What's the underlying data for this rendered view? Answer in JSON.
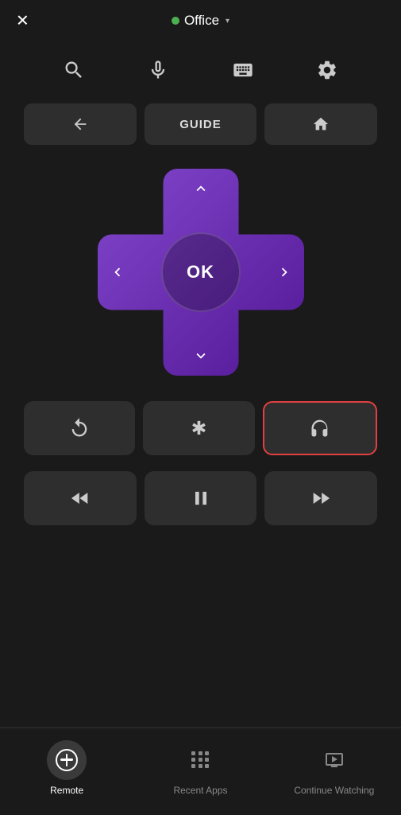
{
  "header": {
    "close_label": "✕",
    "device_name": "Office",
    "dropdown_arrow": "▾",
    "status_color": "#4CAF50"
  },
  "toolbar": {
    "search_label": "search",
    "mic_label": "microphone",
    "keyboard_label": "keyboard",
    "settings_label": "settings"
  },
  "nav_buttons": {
    "back_label": "←",
    "guide_label": "GUIDE",
    "home_label": "⌂"
  },
  "dpad": {
    "ok_label": "OK",
    "up_label": "^",
    "down_label": "v",
    "left_label": "<",
    "right_label": ">"
  },
  "action_buttons": {
    "replay_label": "replay",
    "options_label": "options",
    "headphone_label": "headphone"
  },
  "media_buttons": {
    "rewind_label": "rewind",
    "play_pause_label": "play/pause",
    "fast_forward_label": "fast-forward"
  },
  "bottom_nav": {
    "remote_label": "Remote",
    "recent_apps_label": "Recent Apps",
    "continue_watching_label": "Continue Watching"
  }
}
